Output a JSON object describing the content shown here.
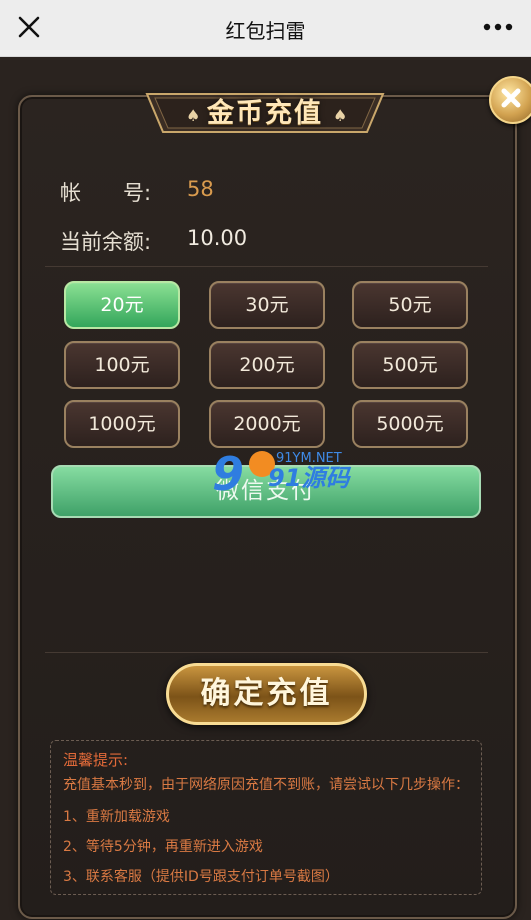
{
  "topbar": {
    "title": "红包扫雷",
    "close_icon": "close-icon",
    "more_icon": "more-dots-icon"
  },
  "panel": {
    "title": "金币充值",
    "account_label": "帐　　号:",
    "account_value": "58",
    "balance_label": "当前余额:",
    "balance_value": "10.00",
    "amounts": [
      "20元",
      "30元",
      "50元",
      "100元",
      "200元",
      "500元",
      "1000元",
      "2000元",
      "5000元"
    ],
    "selected_amount": "20元",
    "pay_method": "微信支付",
    "confirm_label": "确定充值",
    "watermark": {
      "top": "91YM.NET",
      "main": "91源码"
    }
  },
  "tips": {
    "title": "温馨提示:",
    "intro": "充值基本秒到，由于网络原因充值不到账，请尝试以下几步操作：",
    "step1": "1、重新加载游戏",
    "step2": "2、等待5分钟，再重新进入游戏",
    "step3": "3、联系客服（提供ID号跟支付订单号截图）"
  },
  "colors": {
    "accent_gold": "#d4a24c",
    "green_button": "#4fb877",
    "account_value_color": "#d99b4e",
    "tips_text": "#d97943"
  }
}
